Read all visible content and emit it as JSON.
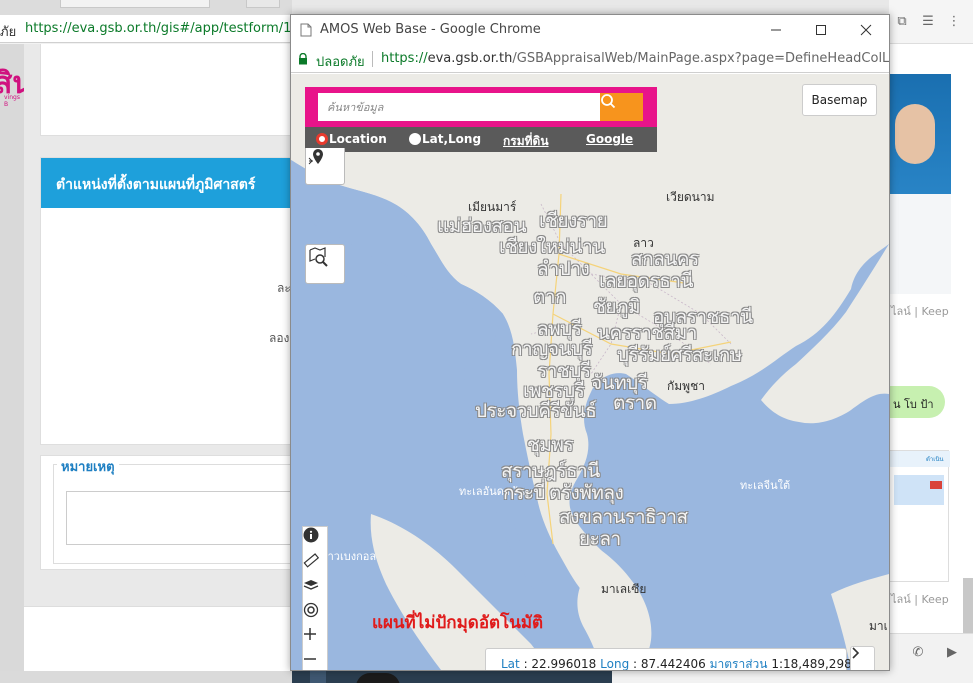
{
  "background_browser": {
    "secure_label": "ภัย",
    "url": "https://eva.gsb.or.th/gis#/app/testform/112",
    "logo_text": "สิน",
    "logo_subtext": "vings B",
    "panel_heading": "ตำแหน่งที่ตั้งตามแผนที่ภูมิศาสตร์",
    "field_label_1": "ละ",
    "field_label_2": "ลอง",
    "remarks_legend": "หมายเหตุ"
  },
  "chat": {
    "meta_1": "ไลน์ | Keep",
    "bubble_text": "น โบ ป้า",
    "meta_2": "ไลน์ | Keep",
    "card_label": "ดำเนิน"
  },
  "popup": {
    "title": "AMOS Web Base - Google Chrome",
    "secure_label": "ปลอดภัย",
    "url_protocol": "https://",
    "url_host": "eva.gsb.or.th",
    "url_path": "/GSBAppraisalWeb/MainPage.aspx?page=DefineHeadColLoca"
  },
  "map": {
    "search": {
      "placeholder": "ค้นหาข้อมูล",
      "options": [
        {
          "label": "Location",
          "selected": true
        },
        {
          "label": "Lat,Long",
          "selected": false
        }
      ],
      "link_land_dept": "กรมที่ดิน",
      "link_google": "Google"
    },
    "basemap_label": "Basemap",
    "no_pin_notice": "แผนที่ไม่ปักมุดอัตโนมัติ",
    "coords": {
      "lat_label": "Lat",
      "lat_value": "22.996018",
      "long_label": "Long",
      "long_value": "87.442406",
      "scale_label": "มาตราส่วน",
      "scale_value": "1:18,489,298"
    },
    "country_labels": {
      "myanmar": "เมียนมาร์",
      "vietnam": "เวียดนาม",
      "laos": "ลาว",
      "cambodia": "กัมพูชา",
      "malaysia": "มาเลเซีย",
      "malaysia_cut": "มาเ"
    },
    "sea_labels": {
      "andaman": "ทะเลอันดามัน",
      "south_china": "ทะเลจีนใต้",
      "bengal": "อ่าวเบงกอล"
    },
    "city_labels": {
      "c1": "แม่ฮ่องสอน",
      "c2": "เชียงราย",
      "c3": "เชียงใหม่น่าน",
      "c4": "ลำปาง",
      "c5": "สกลนคร",
      "c6": "เลยอุดรธานี",
      "c7": "ตาก",
      "c8": "ชัยภูมิ",
      "c9": "อุบลราชธานี",
      "c10": "ลพบุรี",
      "c11": "นครราชสีมา",
      "c12": "กาญจนบุรี",
      "c13": "บุรีรัมย์ศรีสะเกษ",
      "c14": "ราชบุรี",
      "c15": "จันทบุรี",
      "c16": "เพชรบุรี",
      "c17": "ประจวบคีรีขันธ์",
      "c18": "ตราด",
      "c19": "ชุมพร",
      "c20": "สุราษฎร์ธานี",
      "c21": "กระบี่",
      "c22": "ตรังพัทลุง",
      "c23": "สงขลานราธิวาส",
      "c24": "ยะลา"
    }
  },
  "colors": {
    "search_accent": "#e8148a",
    "search_button": "#f7941d",
    "notice_red": "#e01b1b",
    "panel_blue": "#1ea0db",
    "sea": "#9ab7df",
    "land": "#ecebe6"
  }
}
